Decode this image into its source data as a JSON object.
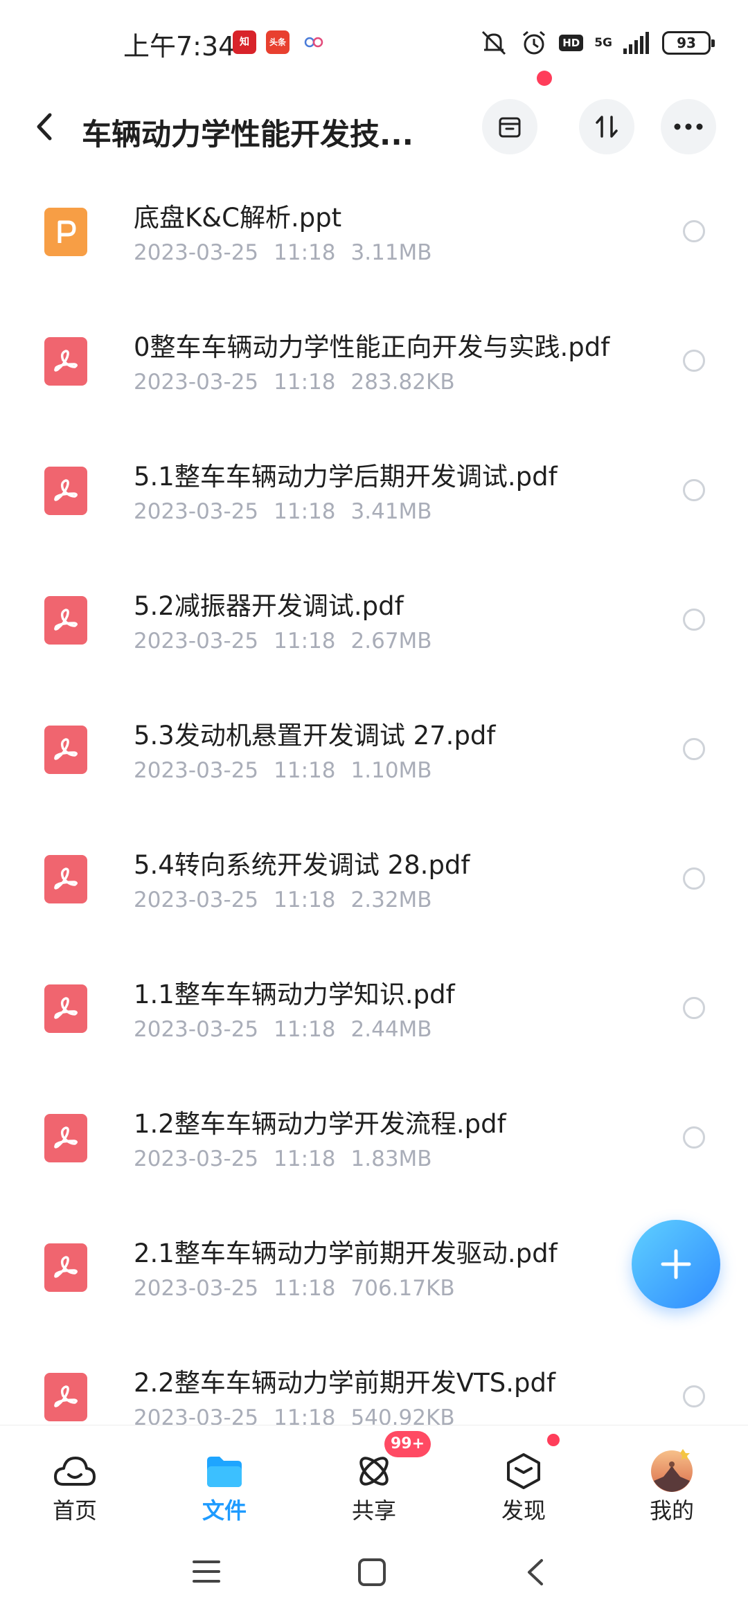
{
  "status_bar": {
    "time": "上午7:34",
    "app_icons": [
      {
        "name": "zhidao-app-icon",
        "text": "知",
        "color": "#d8232a"
      },
      {
        "name": "toutiao-app-icon",
        "text": "头条",
        "color": "#e8402f"
      }
    ],
    "network": "5G",
    "hd": "HD",
    "battery": "93"
  },
  "header": {
    "title": "车辆动力学性能开发技..."
  },
  "files": [
    {
      "name": "底盘K&C解析.ppt",
      "date": "2023-03-25",
      "time": "11:18",
      "size": "3.11MB",
      "type": "ppt"
    },
    {
      "name": "0整车车辆动力学性能正向开发与实践.pdf",
      "date": "2023-03-25",
      "time": "11:18",
      "size": "283.82KB",
      "type": "pdf"
    },
    {
      "name": "5.1整车车辆动力学后期开发调试.pdf",
      "date": "2023-03-25",
      "time": "11:18",
      "size": "3.41MB",
      "type": "pdf"
    },
    {
      "name": "5.2减振器开发调试.pdf",
      "date": "2023-03-25",
      "time": "11:18",
      "size": "2.67MB",
      "type": "pdf"
    },
    {
      "name": "5.3发动机悬置开发调试 27.pdf",
      "date": "2023-03-25",
      "time": "11:18",
      "size": "1.10MB",
      "type": "pdf"
    },
    {
      "name": "5.4转向系统开发调试 28.pdf",
      "date": "2023-03-25",
      "time": "11:18",
      "size": "2.32MB",
      "type": "pdf"
    },
    {
      "name": "1.1整车车辆动力学知识.pdf",
      "date": "2023-03-25",
      "time": "11:18",
      "size": "2.44MB",
      "type": "pdf"
    },
    {
      "name": "1.2整车车辆动力学开发流程.pdf",
      "date": "2023-03-25",
      "time": "11:18",
      "size": "1.83MB",
      "type": "pdf"
    },
    {
      "name": "2.1整车车辆动力学前期开发驱动.pdf",
      "date": "2023-03-25",
      "time": "11:18",
      "size": "706.17KB",
      "type": "pdf"
    },
    {
      "name": "2.2整车车辆动力学前期开发VTS.pdf",
      "date": "2023-03-25",
      "time": "11:18",
      "size": "540.92KB",
      "type": "pdf"
    }
  ],
  "bottom_nav": {
    "items": [
      {
        "label": "首页",
        "icon": "cloud-icon"
      },
      {
        "label": "文件",
        "icon": "folder-icon",
        "active": true
      },
      {
        "label": "共享",
        "icon": "atom-icon",
        "badge": "99+"
      },
      {
        "label": "发现",
        "icon": "cube-icon"
      },
      {
        "label": "我的",
        "icon": "avatar"
      }
    ]
  },
  "colors": {
    "accent": "#1e9bff",
    "pdf_icon": "#f0656f",
    "ppt_icon": "#f79e45",
    "meta_text": "#a9adb8",
    "badge": "#ff4a63"
  }
}
